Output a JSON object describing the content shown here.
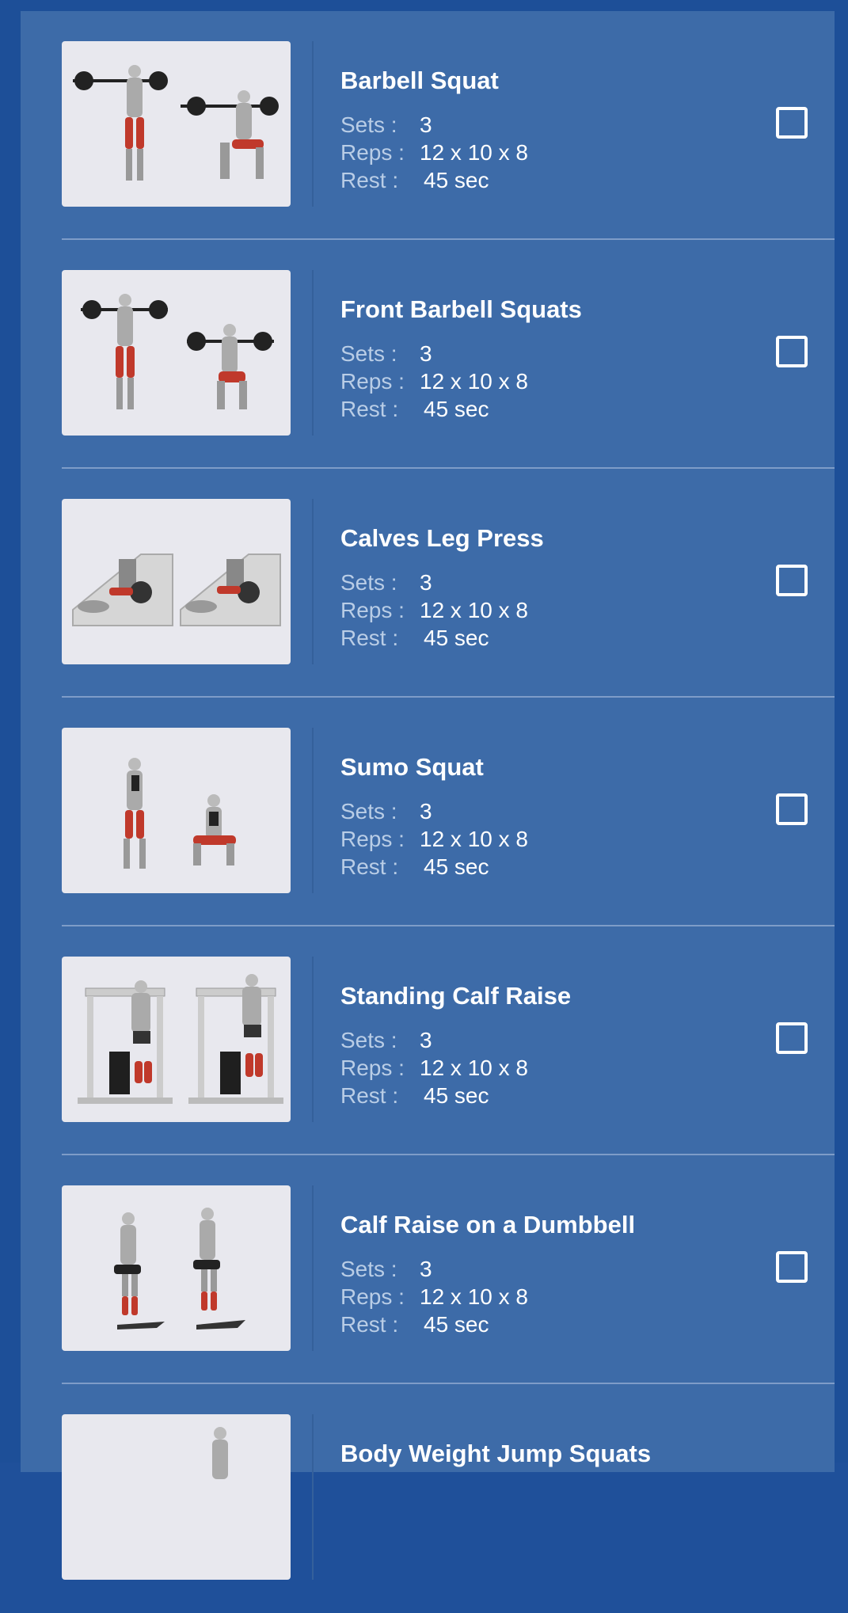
{
  "labels": {
    "sets": "Sets :",
    "reps": "Reps :",
    "rest": "Rest :"
  },
  "exercises": [
    {
      "name": "Barbell Squat",
      "sets": "3",
      "reps": "12 x 10 x 8",
      "rest": "45 sec",
      "image": "barbell-squat-illustration",
      "checked": false
    },
    {
      "name": "Front Barbell Squats",
      "sets": "3",
      "reps": "12 x 10 x 8",
      "rest": "45 sec",
      "image": "front-barbell-squat-illustration",
      "checked": false
    },
    {
      "name": "Calves Leg Press",
      "sets": "3",
      "reps": "12 x 10 x 8",
      "rest": "45 sec",
      "image": "leg-press-illustration",
      "checked": false
    },
    {
      "name": "Sumo Squat",
      "sets": "3",
      "reps": "12 x 10 x 8",
      "rest": "45 sec",
      "image": "sumo-squat-illustration",
      "checked": false
    },
    {
      "name": "Standing Calf Raise",
      "sets": "3",
      "reps": "12 x 10 x 8",
      "rest": "45 sec",
      "image": "standing-calf-raise-illustration",
      "checked": false
    },
    {
      "name": "Calf Raise on a Dumbbell",
      "sets": "3",
      "reps": "12 x 10 x 8",
      "rest": "45 sec",
      "image": "calf-raise-dumbbell-illustration",
      "checked": false
    },
    {
      "name": "Body Weight Jump Squats",
      "sets": "",
      "reps": "",
      "rest": "",
      "image": "jump-squat-illustration",
      "checked": false
    }
  ],
  "colors": {
    "background": "#1d4f98",
    "panel": "#3d6ba8",
    "divider": "#7e9cc8",
    "label": "#b9cde6",
    "text": "#ffffff",
    "muscle_highlight": "#c0392b"
  }
}
